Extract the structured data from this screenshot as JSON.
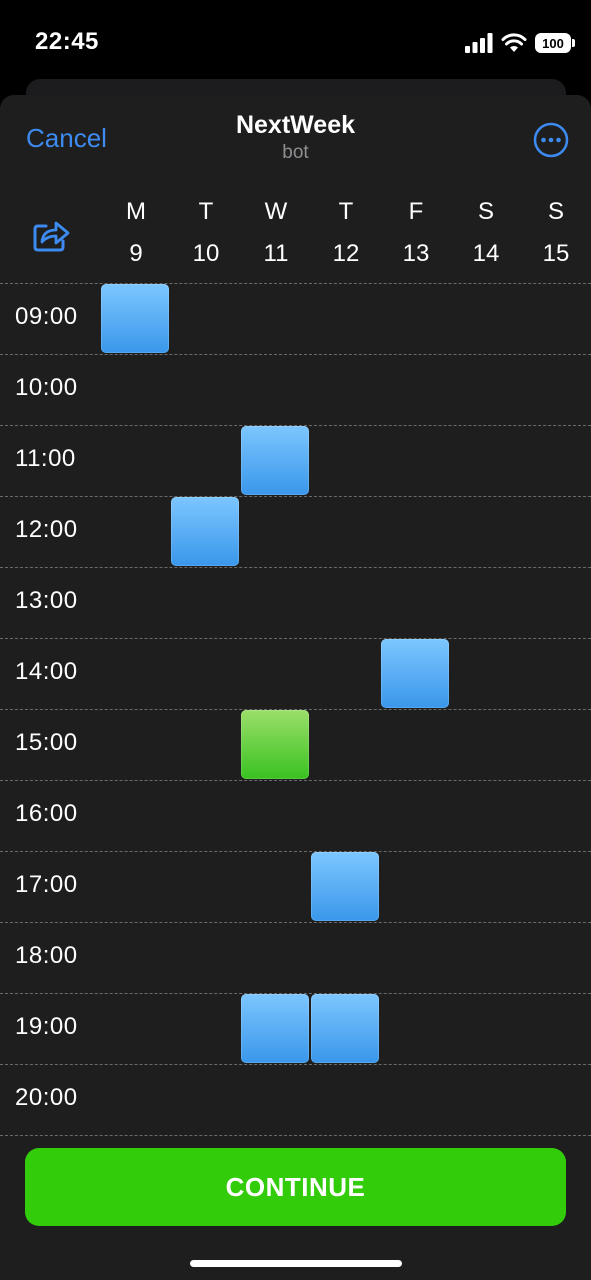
{
  "status_bar": {
    "time": "22:45",
    "battery": "100",
    "icons": [
      "cellular-signal-icon",
      "wifi-icon",
      "battery-icon"
    ]
  },
  "header": {
    "cancel_label": "Cancel",
    "title": "NextWeek",
    "subtitle": "bot",
    "more_icon": "ellipsis-circle-icon",
    "share_icon": "share-icon"
  },
  "days": [
    {
      "letter": "M",
      "num": "9"
    },
    {
      "letter": "T",
      "num": "10"
    },
    {
      "letter": "W",
      "num": "11"
    },
    {
      "letter": "T",
      "num": "12"
    },
    {
      "letter": "F",
      "num": "13"
    },
    {
      "letter": "S",
      "num": "14"
    },
    {
      "letter": "S",
      "num": "15"
    }
  ],
  "hours": [
    "09:00",
    "10:00",
    "11:00",
    "12:00",
    "13:00",
    "14:00",
    "15:00",
    "16:00",
    "17:00",
    "18:00",
    "19:00",
    "20:00"
  ],
  "slots": [
    {
      "day": 0,
      "hour": 0,
      "state": "blue"
    },
    {
      "day": 2,
      "hour": 2,
      "state": "blue"
    },
    {
      "day": 1,
      "hour": 3,
      "state": "blue"
    },
    {
      "day": 4,
      "hour": 5,
      "state": "blue"
    },
    {
      "day": 2,
      "hour": 6,
      "state": "green"
    },
    {
      "day": 3,
      "hour": 8,
      "state": "blue"
    },
    {
      "day": 2,
      "hour": 10,
      "state": "blue"
    },
    {
      "day": 3,
      "hour": 10,
      "state": "blue"
    }
  ],
  "colors": {
    "accent": "#3d8bf0",
    "slot_blue": "#4aa6f2",
    "slot_green": "#5fcf3a",
    "continue": "#33cc0b",
    "sheet_bg": "#1e1e1e"
  },
  "continue_label": "CONTINUE"
}
